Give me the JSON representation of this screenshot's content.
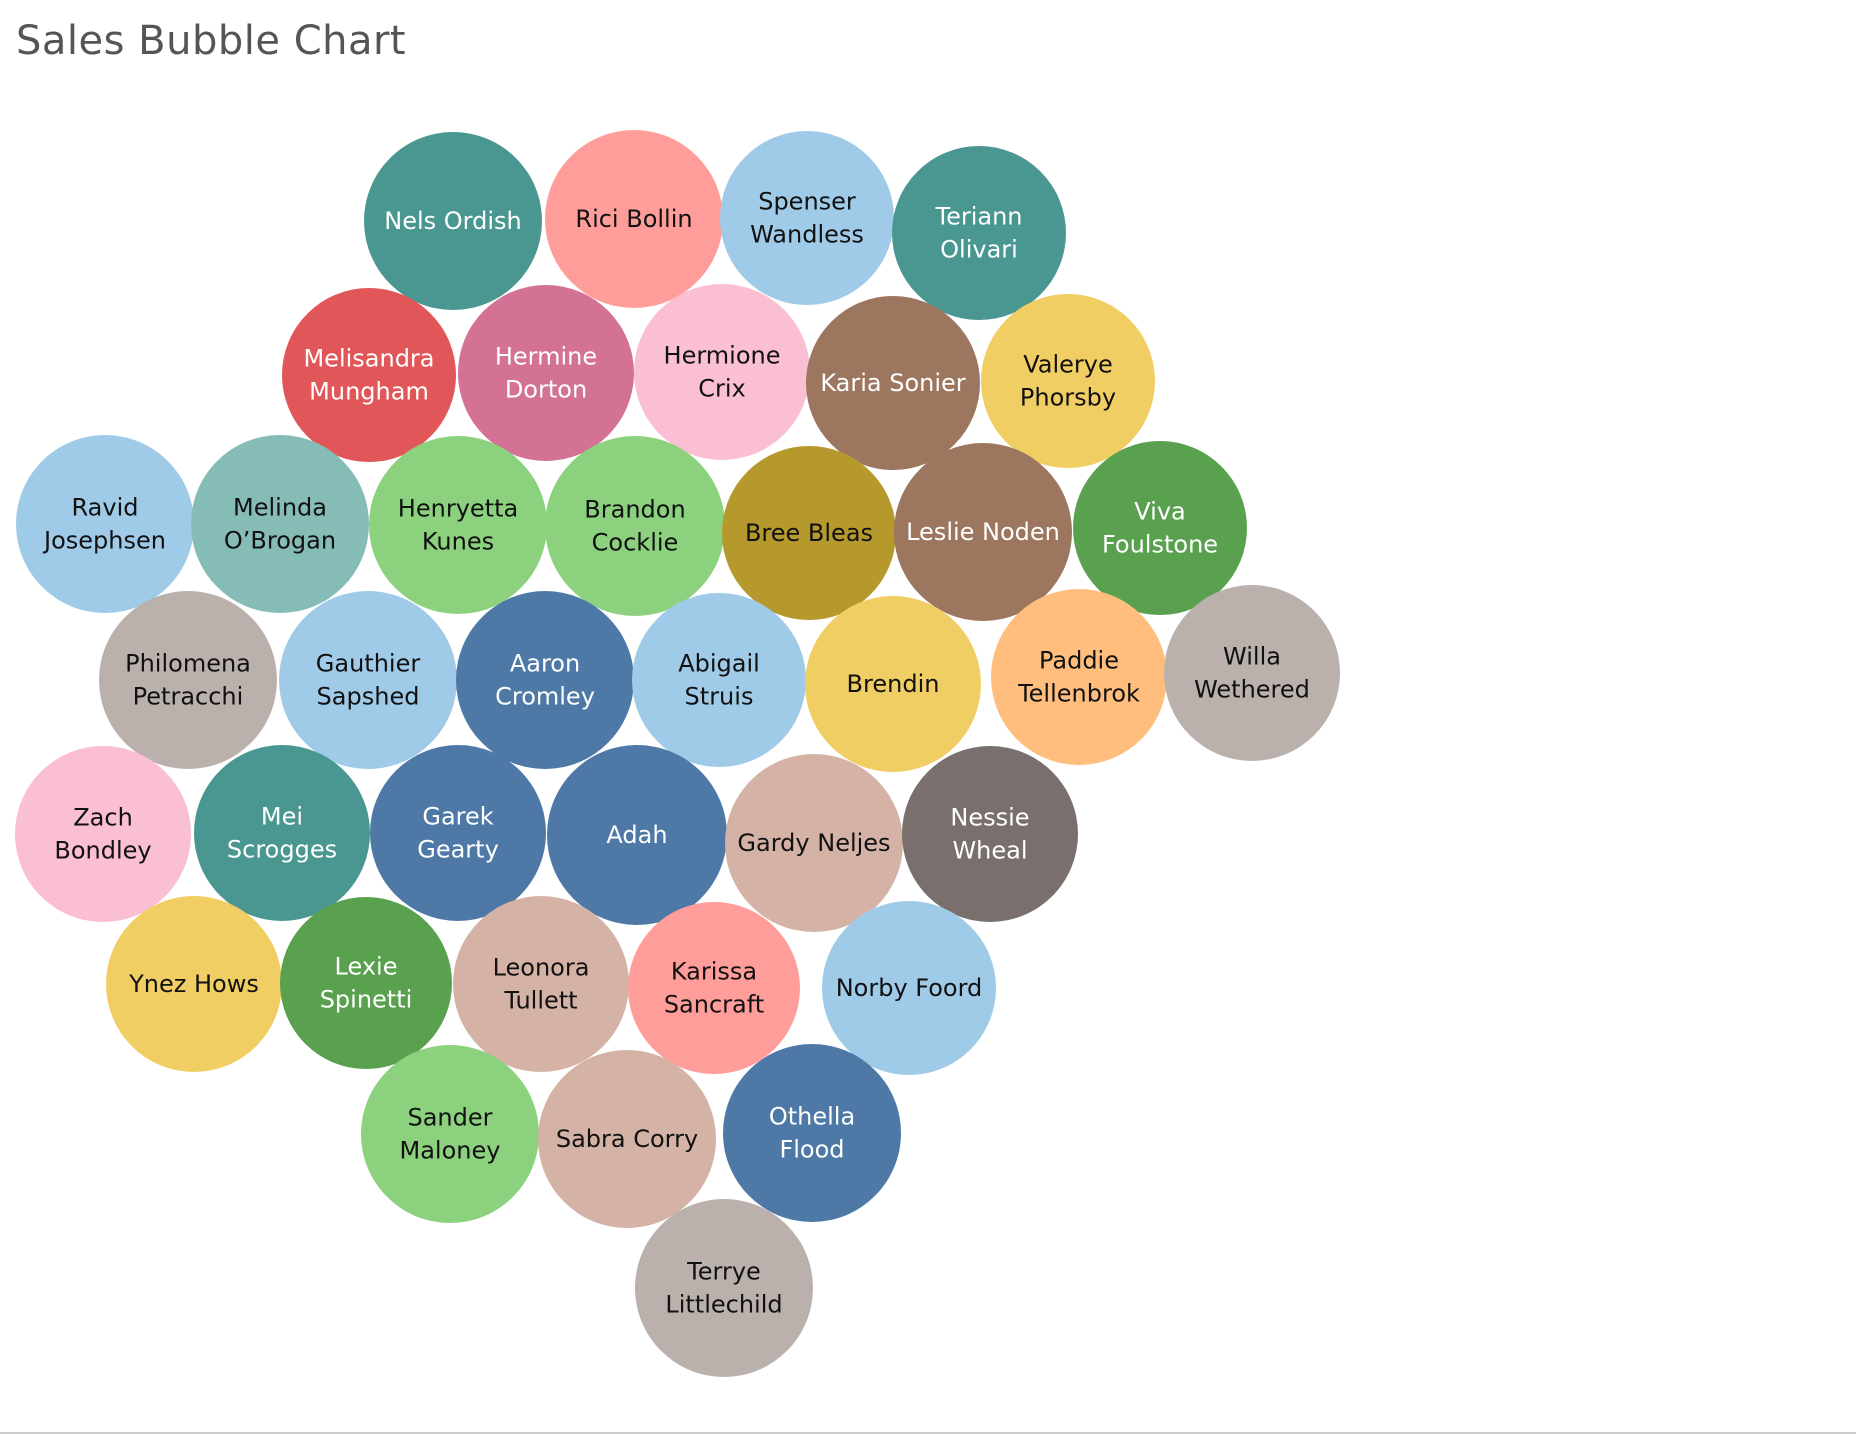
{
  "chart_data": {
    "type": "bubble",
    "title": "Sales Bubble Chart",
    "bubbles": [
      {
        "name": "Nels Ordish",
        "lines": [
          "Nels Ordish"
        ],
        "color": "#4a9791",
        "text_color": "#ffffff"
      },
      {
        "name": "Rici Bollin",
        "lines": [
          "Rici Bollin"
        ],
        "color": "#ff9d9a",
        "text_color": "#111111"
      },
      {
        "name": "Spenser Wandless",
        "lines": [
          "Spenser",
          "Wandless"
        ],
        "color": "#a0cbe8",
        "text_color": "#111111"
      },
      {
        "name": "Teriann Olivari",
        "lines": [
          "Teriann",
          "Olivari"
        ],
        "color": "#4a9791",
        "text_color": "#ffffff"
      },
      {
        "name": "Melisandra Mungham",
        "lines": [
          "Melisandra",
          "Mungham"
        ],
        "color": "#e15759",
        "text_color": "#ffffff"
      },
      {
        "name": "Hermine Dorton",
        "lines": [
          "Hermine",
          "Dorton"
        ],
        "color": "#d37295",
        "text_color": "#ffffff"
      },
      {
        "name": "Hermione Crix",
        "lines": [
          "Hermione",
          "Crix"
        ],
        "color": "#fabfd2",
        "text_color": "#111111"
      },
      {
        "name": "Karia Sonier",
        "lines": [
          "Karia Sonier"
        ],
        "color": "#9d7660",
        "text_color": "#ffffff"
      },
      {
        "name": "Valerye Phorsby",
        "lines": [
          "Valerye",
          "Phorsby"
        ],
        "color": "#f1ce63",
        "text_color": "#111111"
      },
      {
        "name": "Ravid Josephsen",
        "lines": [
          "Ravid",
          "Josephsen"
        ],
        "color": "#a0cbe8",
        "text_color": "#111111"
      },
      {
        "name": "Melinda O’Brogan",
        "lines": [
          "Melinda",
          "O’Brogan"
        ],
        "color": "#86bcb6",
        "text_color": "#111111"
      },
      {
        "name": "Henryetta Kunes",
        "lines": [
          "Henryetta",
          "Kunes"
        ],
        "color": "#8cd17d",
        "text_color": "#111111"
      },
      {
        "name": "Brandon Cocklie",
        "lines": [
          "Brandon",
          "Cocklie"
        ],
        "color": "#8cd17d",
        "text_color": "#111111"
      },
      {
        "name": "Bree Bleas",
        "lines": [
          "Bree Bleas"
        ],
        "color": "#b6992d",
        "text_color": "#111111"
      },
      {
        "name": "Leslie Noden",
        "lines": [
          "Leslie Noden"
        ],
        "color": "#9d7660",
        "text_color": "#ffffff"
      },
      {
        "name": "Viva Foulstone",
        "lines": [
          "Viva",
          "Foulstone"
        ],
        "color": "#59a14f",
        "text_color": "#ffffff"
      },
      {
        "name": "Philomena Petracchi",
        "lines": [
          "Philomena",
          "Petracchi"
        ],
        "color": "#bab0ac",
        "text_color": "#111111"
      },
      {
        "name": "Gauthier Sapshed",
        "lines": [
          "Gauthier",
          "Sapshed"
        ],
        "color": "#a0cbe8",
        "text_color": "#111111"
      },
      {
        "name": "Aaron Cromley",
        "lines": [
          "Aaron",
          "Cromley"
        ],
        "color": "#4e79a7",
        "text_color": "#ffffff"
      },
      {
        "name": "Abigail Struis",
        "lines": [
          "Abigail",
          "Struis"
        ],
        "color": "#a0cbe8",
        "text_color": "#111111"
      },
      {
        "name": "Brendin",
        "lines": [
          "Brendin"
        ],
        "color": "#f1ce63",
        "text_color": "#111111"
      },
      {
        "name": "Paddie Tellenbrok",
        "lines": [
          "Paddie",
          "Tellenbrok"
        ],
        "color": "#ffbe7d",
        "text_color": "#111111"
      },
      {
        "name": "Willa Wethered",
        "lines": [
          "Willa",
          "Wethered"
        ],
        "color": "#bab0ac",
        "text_color": "#111111"
      },
      {
        "name": "Zach Bondley",
        "lines": [
          "Zach",
          "Bondley"
        ],
        "color": "#fabfd2",
        "text_color": "#111111"
      },
      {
        "name": "Mei Scrogges",
        "lines": [
          "Mei",
          "Scrogges"
        ],
        "color": "#4a9791",
        "text_color": "#ffffff"
      },
      {
        "name": "Garek Gearty",
        "lines": [
          "Garek",
          "Gearty"
        ],
        "color": "#4e79a7",
        "text_color": "#ffffff"
      },
      {
        "name": "Adah",
        "lines": [
          "Adah"
        ],
        "color": "#4e79a7",
        "text_color": "#ffffff"
      },
      {
        "name": "Gardy Neljes",
        "lines": [
          "Gardy Neljes"
        ],
        "color": "#d4b3a6",
        "text_color": "#111111"
      },
      {
        "name": "Nessie Wheal",
        "lines": [
          "Nessie",
          "Wheal"
        ],
        "color": "#79706e",
        "text_color": "#ffffff"
      },
      {
        "name": "Ynez Hows",
        "lines": [
          "Ynez Hows"
        ],
        "color": "#f1ce63",
        "text_color": "#111111"
      },
      {
        "name": "Lexie Spinetti",
        "lines": [
          "Lexie",
          "Spinetti"
        ],
        "color": "#59a14f",
        "text_color": "#ffffff"
      },
      {
        "name": "Leonora Tullett",
        "lines": [
          "Leonora",
          "Tullett"
        ],
        "color": "#d4b3a6",
        "text_color": "#111111"
      },
      {
        "name": "Karissa Sancraft",
        "lines": [
          "Karissa",
          "Sancraft"
        ],
        "color": "#ff9d9a",
        "text_color": "#111111"
      },
      {
        "name": "Norby Foord",
        "lines": [
          "Norby Foord"
        ],
        "color": "#a0cbe8",
        "text_color": "#111111"
      },
      {
        "name": "Sander Maloney",
        "lines": [
          "Sander",
          "Maloney"
        ],
        "color": "#8cd17d",
        "text_color": "#111111"
      },
      {
        "name": "Sabra Corry",
        "lines": [
          "Sabra Corry"
        ],
        "color": "#d4b3a6",
        "text_color": "#111111"
      },
      {
        "name": "Othella Flood",
        "lines": [
          "Othella",
          "Flood"
        ],
        "color": "#4e79a7",
        "text_color": "#ffffff"
      },
      {
        "name": "Terrye Littlechild",
        "lines": [
          "Terrye",
          "Littlechild"
        ],
        "color": "#bab0ac",
        "text_color": "#111111"
      }
    ]
  }
}
